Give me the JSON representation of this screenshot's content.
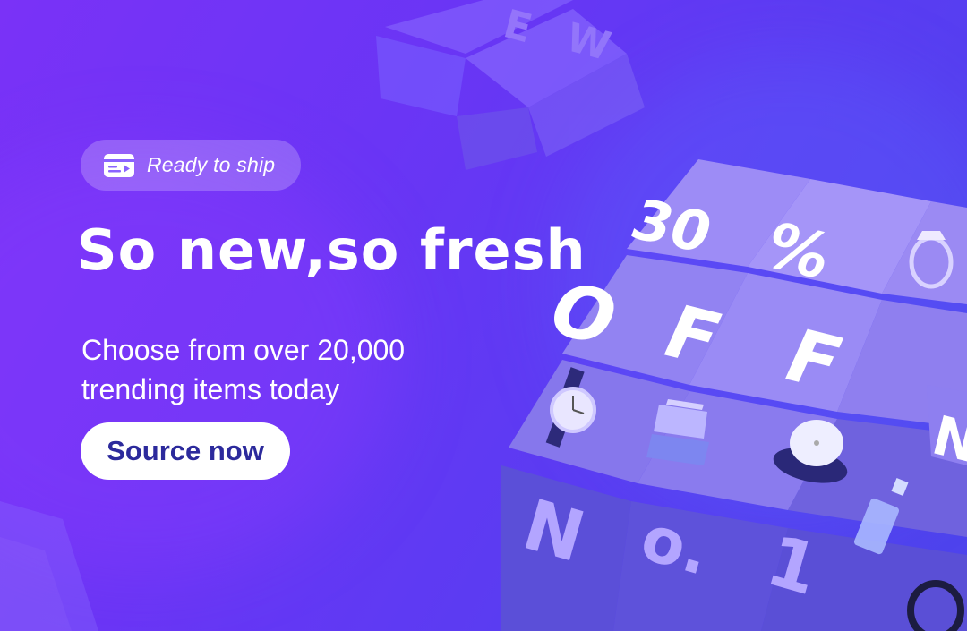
{
  "badge": {
    "label": "Ready to ship",
    "icon": "shipping-box-icon"
  },
  "headline": "So new,so fresh",
  "subheadline": {
    "line1": "Choose from over 20,000",
    "line2": "trending items today"
  },
  "cta": {
    "label": "Source now"
  },
  "cube": {
    "face_tiles": [
      "30",
      "%",
      "O",
      "F",
      "F",
      "N",
      "o.",
      "1"
    ],
    "icons": [
      "ring-icon",
      "watch-icon",
      "card-holder-icon",
      "cap-icon",
      "perfume-icon",
      "bracelet-icon"
    ]
  },
  "top_cube": {
    "face_tiles": [
      "E",
      "W"
    ]
  },
  "colors": {
    "bg_start": "#7a32f7",
    "bg_end": "#4c44ec",
    "cta_text": "#2c2a9c",
    "text": "#ffffff"
  }
}
